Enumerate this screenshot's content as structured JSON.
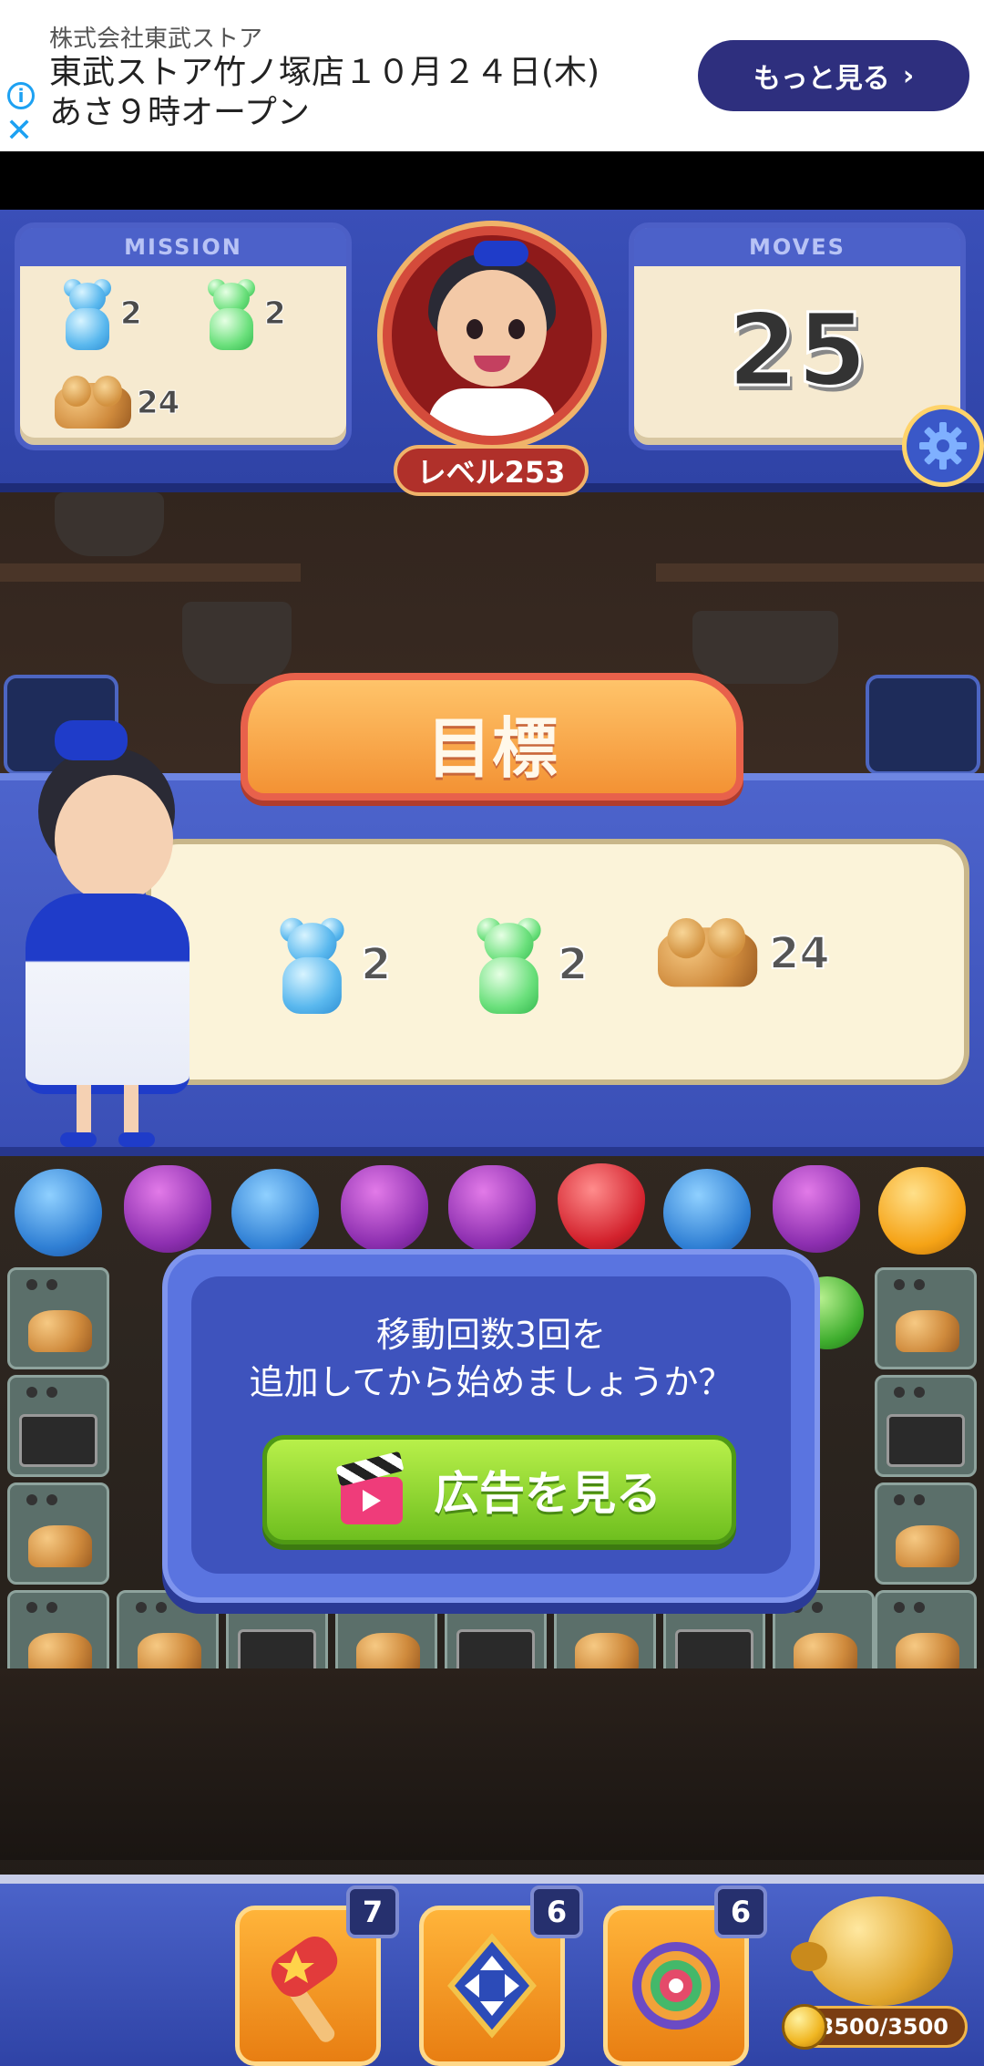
{
  "ad": {
    "company": "株式会社東武ストア",
    "headline_line1": "東武ストア竹ノ塚店１０月２４日(木)",
    "headline_line2": "あさ９時オープン",
    "more_label": "もっと見る",
    "info_icon": "info-icon",
    "close_icon": "close-icon"
  },
  "hud": {
    "mission_title": "MISSION",
    "moves_title": "MOVES",
    "moves_value": "25",
    "level_label": "レベル253",
    "missions": [
      {
        "item": "blue-gummy-bear",
        "count": "2"
      },
      {
        "item": "green-gummy-bear",
        "count": "2"
      },
      {
        "item": "bread",
        "count": "24"
      }
    ]
  },
  "objective": {
    "title": "目標",
    "goals": [
      {
        "item": "blue-gummy-bear",
        "count": "2"
      },
      {
        "item": "green-gummy-bear",
        "count": "2"
      },
      {
        "item": "bread",
        "count": "24"
      }
    ]
  },
  "popup": {
    "message_line1": "移動回数3回を",
    "message_line2": "追加してから始めましょうか？",
    "watch_ad_label": "広告を見る"
  },
  "boosters": [
    {
      "name": "hammer",
      "count": "7"
    },
    {
      "name": "swap",
      "count": "6"
    },
    {
      "name": "rainbow",
      "count": "6"
    }
  ],
  "piggy_bank": {
    "coins": "3500/3500"
  },
  "colors": {
    "hud_blue": "#3a4fb8",
    "ad_button": "#2e2f7e",
    "watch_button": "#6fbf1f",
    "banner_orange": "#f39234"
  }
}
